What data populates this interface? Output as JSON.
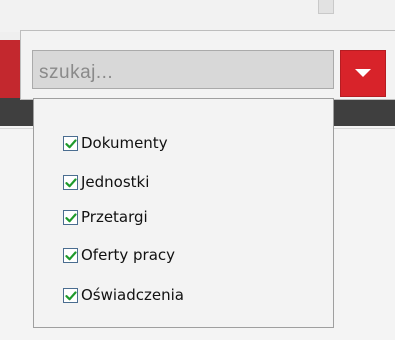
{
  "search": {
    "placeholder": "szukaj..."
  },
  "filters": {
    "items": [
      {
        "label": "Dokumenty",
        "checked": true
      },
      {
        "label": "Jednostki",
        "checked": true
      },
      {
        "label": "Przetargi",
        "checked": true
      },
      {
        "label": "Oferty pracy",
        "checked": true
      },
      {
        "label": "Oświadczenia",
        "checked": true
      }
    ]
  },
  "colors": {
    "accent_red": "#d8232a",
    "checkmark_green": "#1f9a2c"
  },
  "icons": {
    "dropdown": "chevron-down-icon",
    "checkbox": "checkbox-checked-icon"
  }
}
